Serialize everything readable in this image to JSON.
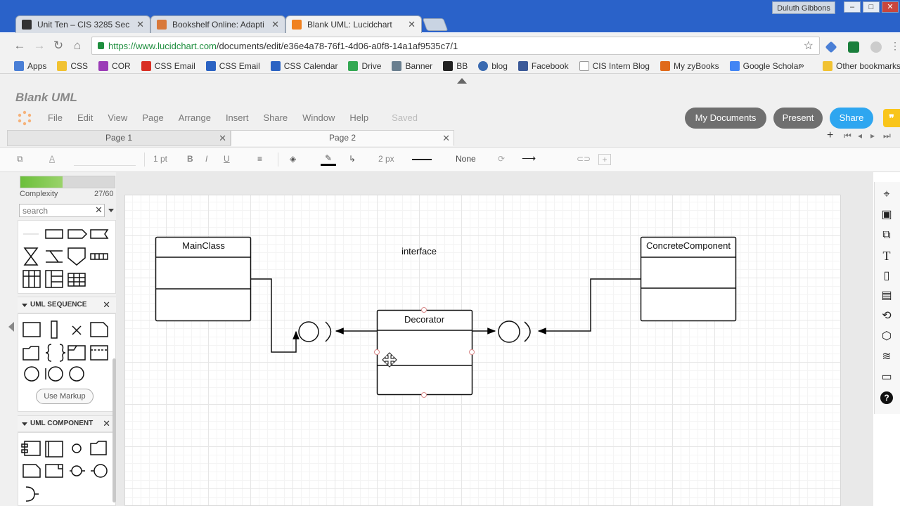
{
  "browser": {
    "profile_name": "Duluth Gibbons",
    "window_controls": [
      "–",
      "□",
      "✕"
    ],
    "tabs": [
      {
        "title": "Unit Ten – CIS 3285 Sec",
        "icon": "blackboard-icon",
        "color": "#333333"
      },
      {
        "title": "Bookshelf Online: Adapti",
        "icon": "bookshelf-icon",
        "color": "#d8783a"
      },
      {
        "title": "Blank UML: Lucidchart",
        "icon": "lucidchart-icon",
        "color": "#f0811f",
        "active": true
      }
    ],
    "url_host": "https://www.lucidchart.com",
    "url_path": "/documents/edit/e36e4a78-76f1-4d06-a0f8-14a1af9535c7/1",
    "bookmarks": [
      {
        "label": "Apps",
        "color": "#4a7fd6"
      },
      {
        "label": "CSS",
        "color": "#f1c232"
      },
      {
        "label": "COR",
        "color": "#9b3cb7"
      },
      {
        "label": "CSS Email",
        "color": "#d93025"
      },
      {
        "label": "CSS Email",
        "color": "#2b63c3"
      },
      {
        "label": "CSS Calendar",
        "color": "#2b63c3"
      },
      {
        "label": "Drive",
        "color": "#34a853"
      },
      {
        "label": "Banner",
        "color": "#6a7f8f"
      },
      {
        "label": "BB",
        "color": "#222222"
      },
      {
        "label": "blog",
        "color": "#3a6ab0"
      },
      {
        "label": "Facebook",
        "color": "#3b5998"
      },
      {
        "label": "CIS Intern Blog",
        "color": "#999999"
      },
      {
        "label": "My zyBooks",
        "color": "#e06a1b"
      },
      {
        "label": "Google Scholar",
        "color": "#4285f4"
      }
    ],
    "bookmarks_overflow": "»",
    "other_bookmarks": "Other bookmarks"
  },
  "app": {
    "doc_title": "Blank UML",
    "menu": [
      "File",
      "Edit",
      "View",
      "Page",
      "Arrange",
      "Insert",
      "Share",
      "Window",
      "Help"
    ],
    "saved_status": "Saved",
    "buttons": {
      "my_documents": "My Documents",
      "present": "Present",
      "share": "Share"
    },
    "accent": "#2ea6f0",
    "page_tabs": [
      "Page 1",
      "Page 2"
    ],
    "active_page": "Page 2",
    "format": {
      "line_width": "1 pt",
      "border_width": "2 px",
      "arrow_start": "None"
    }
  },
  "left_panel": {
    "complexity_label": "Complexity",
    "complexity_value": "27/60",
    "complexity_fraction": 0.45,
    "search_placeholder": "search",
    "sections": [
      "UML SEQUENCE",
      "UML COMPONENT"
    ],
    "use_markup": "Use Markup"
  },
  "diagram": {
    "classes": [
      "MainClass",
      "ConcreteComponent",
      "Decorator"
    ],
    "interface_label": "interface"
  }
}
